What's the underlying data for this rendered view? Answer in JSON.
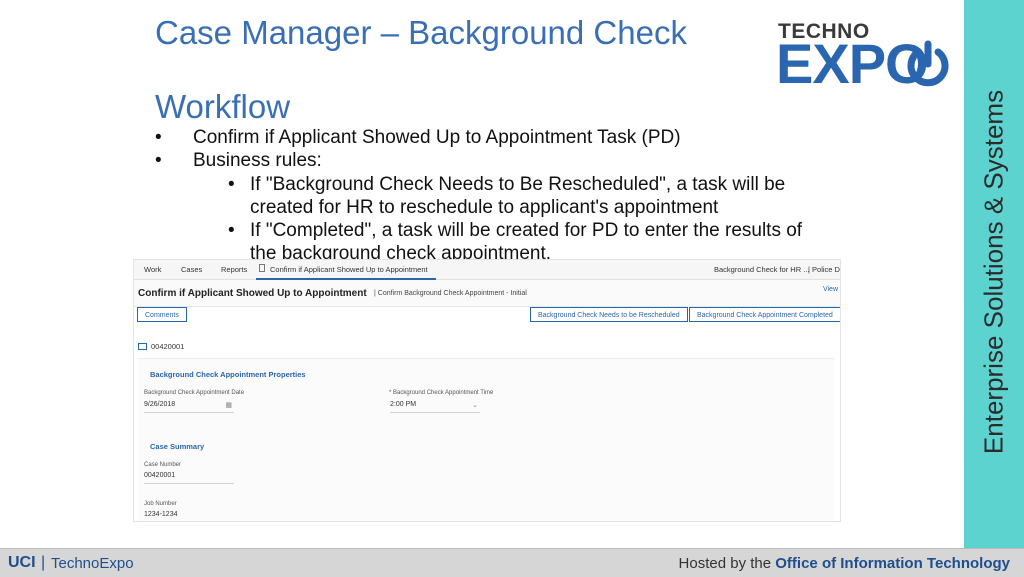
{
  "slide": {
    "title": "Case Manager – Background Check",
    "workflow_heading": "Workflow",
    "bullets": [
      "Confirm if Applicant Showed Up to Appointment Task (PD)",
      "Business rules:"
    ],
    "sub_bullets": [
      "If \"Background Check Needs to Be Rescheduled\", a task will be created for HR to reschedule to applicant's appointment",
      "If \"Completed\", a task will be created for PD to enter the results of the background check appointment."
    ],
    "bullet_glyph": "•"
  },
  "logo": {
    "top": "TECHNO",
    "main": "EXPO"
  },
  "sidebar": {
    "text": "Enterprise Solutions & Systems",
    "color": "#5dd3cf"
  },
  "app": {
    "nav": {
      "work": "Work",
      "cases": "Cases",
      "reports": "Reports"
    },
    "active_tab": "Confirm if Applicant Showed Up to Appointment",
    "right_tab": "Background Check for HR ...",
    "right_tab2": "| Police De",
    "page_title": "Confirm if Applicant Showed Up to Appointment",
    "page_subtitle": "| Confirm Background Check Appointment - Initial",
    "view_link": "View",
    "comments_button": "Comments",
    "reschedule_button": "Background Check Needs to be Rescheduled",
    "completed_button": "Background Check Appointment Completed",
    "case_id": "00420001",
    "properties_section": "Background Check Appointment Properties",
    "date_label": "Background Check Appointment Date",
    "date_value": "9/26/2018",
    "time_label": "* Background Check Appointment Time",
    "time_value": "2:00 PM",
    "summary_section": "Case Summary",
    "case_number_label": "Case Number",
    "case_number_value": "00420001",
    "job_number_label": "Job Number",
    "job_number_value": "1234-1234"
  },
  "footer": {
    "uci": "UCI",
    "separator": "|",
    "technoexpo": "TechnoExpo",
    "hosted_prefix": "Hosted by the",
    "hosted_org": "Office of Information Technology"
  },
  "colors": {
    "title_blue": "#3a6fb5",
    "brand_blue": "#2a66b0",
    "sidebar_teal": "#5dd3cf"
  }
}
